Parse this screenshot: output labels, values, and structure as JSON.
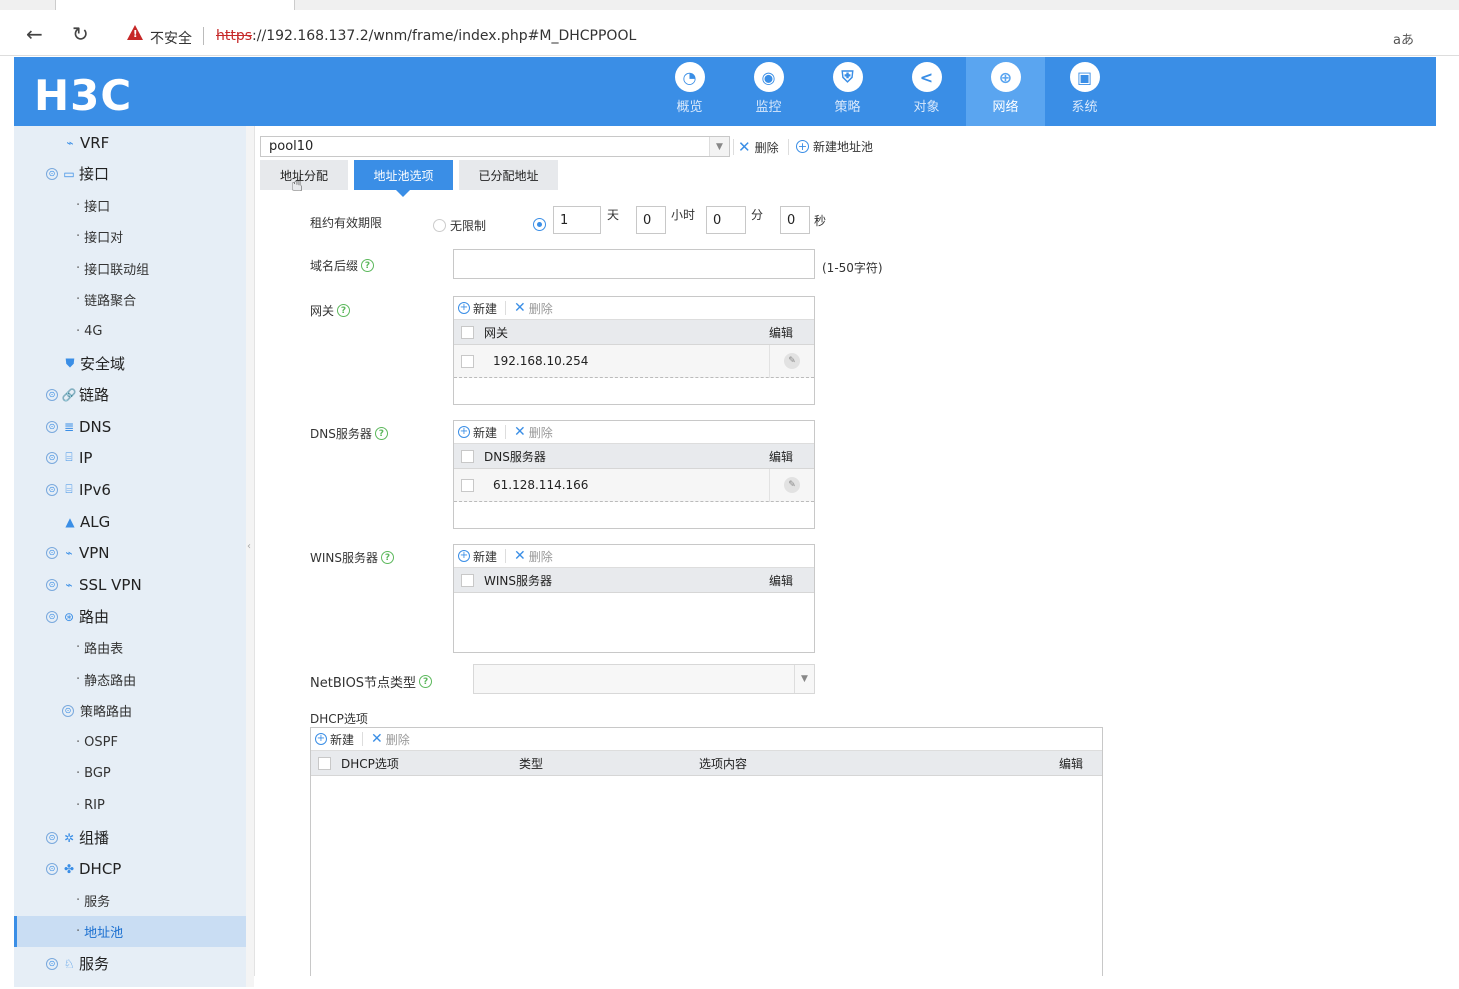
{
  "browser": {
    "insecure_label": "不安全",
    "url_scheme": "https",
    "url_rest": "://192.168.137.2/wnm/frame/index.php#M_DHCPPOOL",
    "translate_label": "aあ"
  },
  "header": {
    "logo": "H3C",
    "nav": [
      {
        "label": "概览",
        "icon": "dashboard-icon"
      },
      {
        "label": "监控",
        "icon": "monitor-icon"
      },
      {
        "label": "策略",
        "icon": "policy-shield-icon"
      },
      {
        "label": "对象",
        "icon": "share-object-icon"
      },
      {
        "label": "网络",
        "icon": "globe-network-icon",
        "active": true
      },
      {
        "label": "系统",
        "icon": "system-screen-icon"
      }
    ]
  },
  "sidebar": {
    "items": [
      {
        "label": "VRF",
        "level": 1
      },
      {
        "label": "接口",
        "level": 0
      },
      {
        "label": "接口",
        "level": 2
      },
      {
        "label": "接口对",
        "level": 2
      },
      {
        "label": "接口联动组",
        "level": 2
      },
      {
        "label": "链路聚合",
        "level": 2
      },
      {
        "label": "4G",
        "level": 2
      },
      {
        "label": "安全域",
        "level": 1
      },
      {
        "label": "链路",
        "level": 0
      },
      {
        "label": "DNS",
        "level": 0
      },
      {
        "label": "IP",
        "level": 0
      },
      {
        "label": "IPv6",
        "level": 0
      },
      {
        "label": "ALG",
        "level": 1
      },
      {
        "label": "VPN",
        "level": 0
      },
      {
        "label": "SSL VPN",
        "level": 0
      },
      {
        "label": "路由",
        "level": 0
      },
      {
        "label": "路由表",
        "level": 2
      },
      {
        "label": "静态路由",
        "level": 2
      },
      {
        "label": "策略路由",
        "level": 1
      },
      {
        "label": "OSPF",
        "level": 2
      },
      {
        "label": "BGP",
        "level": 2
      },
      {
        "label": "RIP",
        "level": 2
      },
      {
        "label": "组播",
        "level": 0
      },
      {
        "label": "DHCP",
        "level": 0
      },
      {
        "label": "服务",
        "level": 2
      },
      {
        "label": "地址池",
        "level": 2,
        "active": true
      },
      {
        "label": "服务",
        "level": 0
      }
    ]
  },
  "toolbar": {
    "pool_value": "pool10",
    "delete_label": "删除",
    "new_pool_label": "新建地址池"
  },
  "tabs": [
    {
      "label": "地址分配"
    },
    {
      "label": "地址池选项",
      "active": true
    },
    {
      "label": "已分配地址"
    }
  ],
  "form": {
    "lease_label": "租约有效期限",
    "unlimited_label": "无限制",
    "days_value": "1",
    "days_unit": "天",
    "hours_value": "0",
    "hours_unit": "小时",
    "minutes_value": "0",
    "minutes_unit": "分",
    "seconds_value": "0",
    "seconds_unit": "秒",
    "domain_label": "域名后缀",
    "domain_value": "",
    "domain_hint": "(1-50字符)",
    "gateway_label": "网关",
    "dns_label": "DNS服务器",
    "wins_label": "WINS服务器",
    "netbios_label": "NetBIOS节点类型",
    "netbios_value": "",
    "dhcp_options_label": "DHCP选项"
  },
  "grid_common": {
    "new_label": "新建",
    "delete_label": "删除",
    "edit_col": "编辑"
  },
  "gateway_grid": {
    "header": "网关",
    "rows": [
      "192.168.10.254"
    ]
  },
  "dns_grid": {
    "header": "DNS服务器",
    "rows": [
      "61.128.114.166"
    ]
  },
  "wins_grid": {
    "header": "WINS服务器",
    "rows": []
  },
  "options_grid": {
    "columns": [
      "DHCP选项",
      "类型",
      "选项内容",
      "编辑"
    ]
  }
}
